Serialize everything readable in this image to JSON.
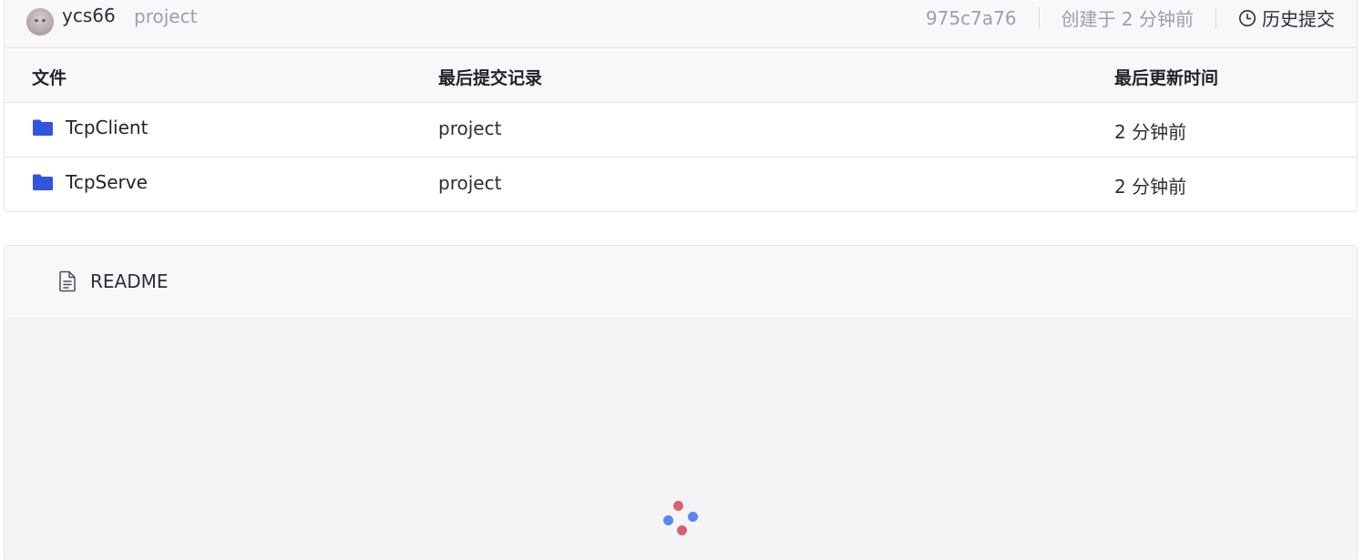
{
  "commit": {
    "author": "ycs66",
    "message": "project",
    "sha": "975c7a76",
    "created": "创建于 2 分钟前",
    "history_label": "历史提交"
  },
  "table": {
    "headers": {
      "file": "文件",
      "last_commit": "最后提交记录",
      "updated": "最后更新时间"
    },
    "rows": [
      {
        "name": "TcpClient",
        "message": "project",
        "time": "2 分钟前",
        "icon": "folder-icon"
      },
      {
        "name": "TcpServe",
        "message": "project",
        "time": "2 分钟前",
        "icon": "folder-icon"
      }
    ]
  },
  "readme": {
    "title": "README",
    "icon": "document-icon",
    "loading": true
  },
  "colors": {
    "folder": "#3056e0",
    "loader_blue": "#5b86f0",
    "loader_red": "#d9606e",
    "header_bg": "#f8f8fa",
    "border": "#e4e6eb"
  }
}
